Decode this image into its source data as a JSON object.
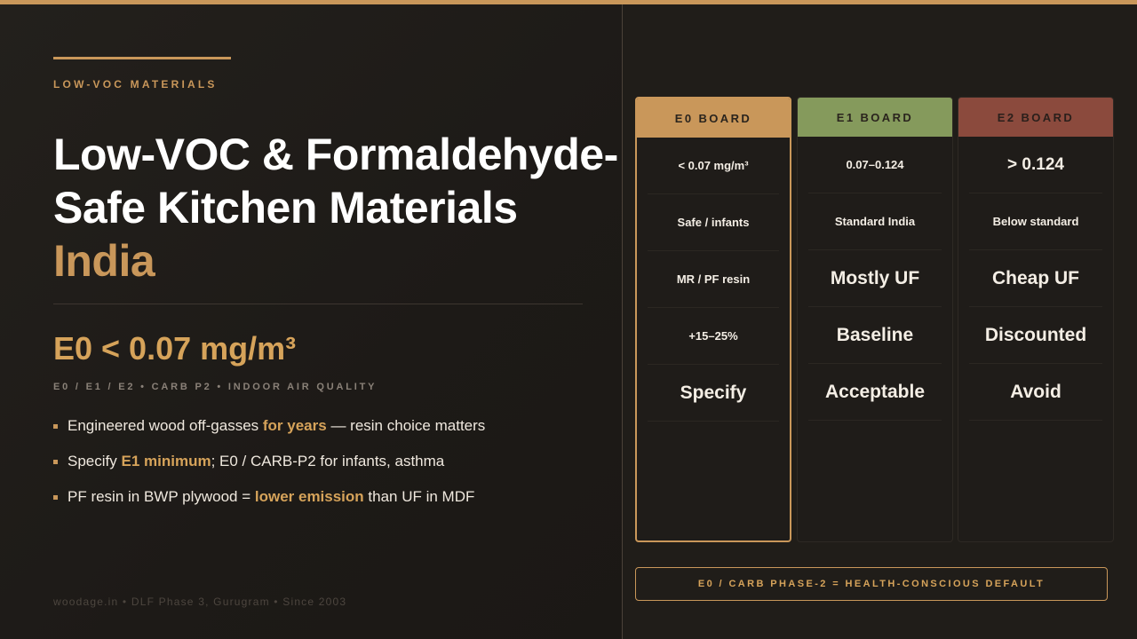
{
  "eyebrow": "LOW-VOC MATERIALS",
  "title": {
    "line1": "Low-VOC & Formaldehyde-",
    "line2": "Safe Kitchen Materials",
    "line3": "India"
  },
  "stat": "E0 < 0.07 mg/m³",
  "subline": "E0 / E1 / E2 • CARB P2 • INDOOR AIR QUALITY",
  "bullets": [
    {
      "pre": "Engineered wood off-gasses ",
      "hl": "for years",
      "post": " — resin choice matters"
    },
    {
      "pre": "Specify ",
      "hl": "E1 minimum",
      "post": "; E0 / CARB-P2 for infants, asthma"
    },
    {
      "pre": "PF resin in BWP plywood = ",
      "hl": "lower emission",
      "post": " than UF in MDF"
    }
  ],
  "footer": "woodage.in • DLF Phase 3, Gurugram • Since 2003",
  "columns": [
    {
      "header": "E0 BOARD",
      "cells": [
        "< 0.07 mg/m³",
        "Safe / infants",
        "MR / PF resin",
        "+15–25%",
        "Specify"
      ]
    },
    {
      "header": "E1 BOARD",
      "cells": [
        "0.07–0.124",
        "Standard India",
        "Mostly UF",
        "Baseline",
        "Acceptable"
      ]
    },
    {
      "header": "E2 BOARD",
      "cells": [
        "> 0.124",
        "Below standard",
        "Cheap UF",
        "Discounted",
        "Avoid"
      ]
    }
  ],
  "banner": "E0 / CARB PHASE-2 = HEALTH-CONSCIOUS DEFAULT",
  "colors": {
    "accent": "#c9975a",
    "e0": "#c9975a",
    "e1": "#859a5c",
    "e2": "#8b4a3d",
    "background": "#1d1a17"
  }
}
